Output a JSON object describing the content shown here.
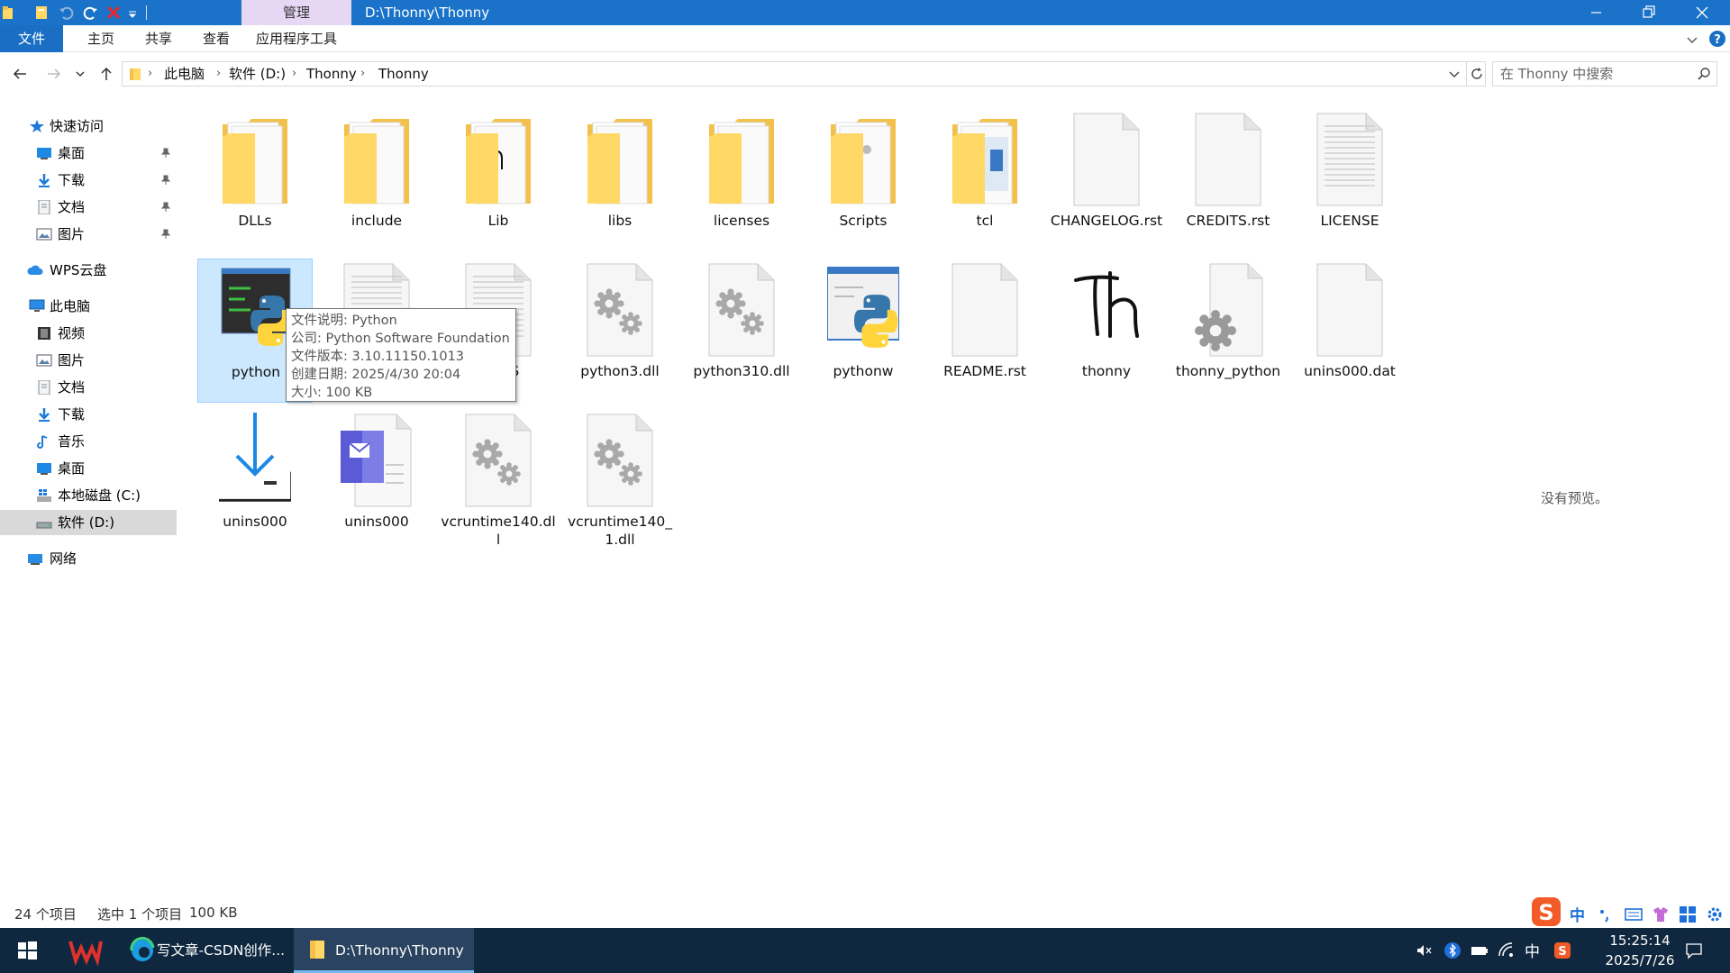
{
  "titlebar": {
    "context_tab": "管理",
    "title": "D:\\Thonny\\Thonny"
  },
  "ribbon": {
    "tabs": [
      "文件",
      "主页",
      "共享",
      "查看",
      "应用程序工具"
    ]
  },
  "address": {
    "crumbs": [
      "此电脑",
      "软件 (D:)",
      "Thonny",
      "Thonny"
    ],
    "search_placeholder": "在 Thonny 中搜索"
  },
  "nav": {
    "quick_access": "快速访问",
    "qa_items": [
      "桌面",
      "下载",
      "文档",
      "图片"
    ],
    "wps": "WPS云盘",
    "this_pc": "此电脑",
    "pc_items": [
      "视频",
      "图片",
      "文档",
      "下载",
      "音乐",
      "桌面",
      "本地磁盘 (C:)",
      "软件 (D:)"
    ],
    "network": "网络"
  },
  "files": [
    {
      "name": "DLLs",
      "kind": "folder"
    },
    {
      "name": "include",
      "kind": "folder"
    },
    {
      "name": "Lib",
      "kind": "folder"
    },
    {
      "name": "libs",
      "kind": "folder"
    },
    {
      "name": "licenses",
      "kind": "folder"
    },
    {
      "name": "Scripts",
      "kind": "folder"
    },
    {
      "name": "tcl",
      "kind": "folder"
    },
    {
      "name": "CHANGELOG.rst",
      "kind": "file"
    },
    {
      "name": "CREDITS.rst",
      "kind": "file"
    },
    {
      "name": "LICENSE",
      "kind": "text"
    },
    {
      "name": "python",
      "kind": "python-exe"
    },
    {
      "name": "NEWS",
      "kind": "text"
    },
    {
      "name": "NEWS",
      "kind": "text"
    },
    {
      "name": "python3.dll",
      "kind": "dll"
    },
    {
      "name": "python310.dll",
      "kind": "dll"
    },
    {
      "name": "pythonw",
      "kind": "pythonw-exe"
    },
    {
      "name": "README.rst",
      "kind": "file"
    },
    {
      "name": "thonny",
      "kind": "thonny"
    },
    {
      "name": "thonny_python",
      "kind": "gear-file"
    },
    {
      "name": "unins000.dat",
      "kind": "file"
    },
    {
      "name": "unins000",
      "kind": "uninstall"
    },
    {
      "name": "unins000",
      "kind": "msg"
    },
    {
      "name": "vcruntime140.dll",
      "kind": "dll"
    },
    {
      "name": "vcruntime140_1.dll",
      "kind": "dll"
    }
  ],
  "tooltip": {
    "lines": [
      "文件说明: Python",
      "公司: Python Software Foundation",
      "文件版本: 3.10.11150.1013",
      "创建日期: 2025/4/30 20:04",
      "大小: 100 KB"
    ]
  },
  "preview": "没有预览。",
  "status": {
    "count": "24 个项目",
    "selected": "选中 1 个项目",
    "size": "100 KB"
  },
  "taskbar": {
    "edge_label": "写文章-CSDN创作...",
    "explorer_label": "D:\\Thonny\\Thonny",
    "ime_char": "中",
    "time": "15:25:14",
    "date": "2025/7/26"
  },
  "ime_bar": {
    "char": "中"
  },
  "colors": {
    "titlebar": "#1a73c8",
    "context_tab": "#e6d7f4",
    "selection": "#cce8ff",
    "taskbar": "#10283f"
  }
}
